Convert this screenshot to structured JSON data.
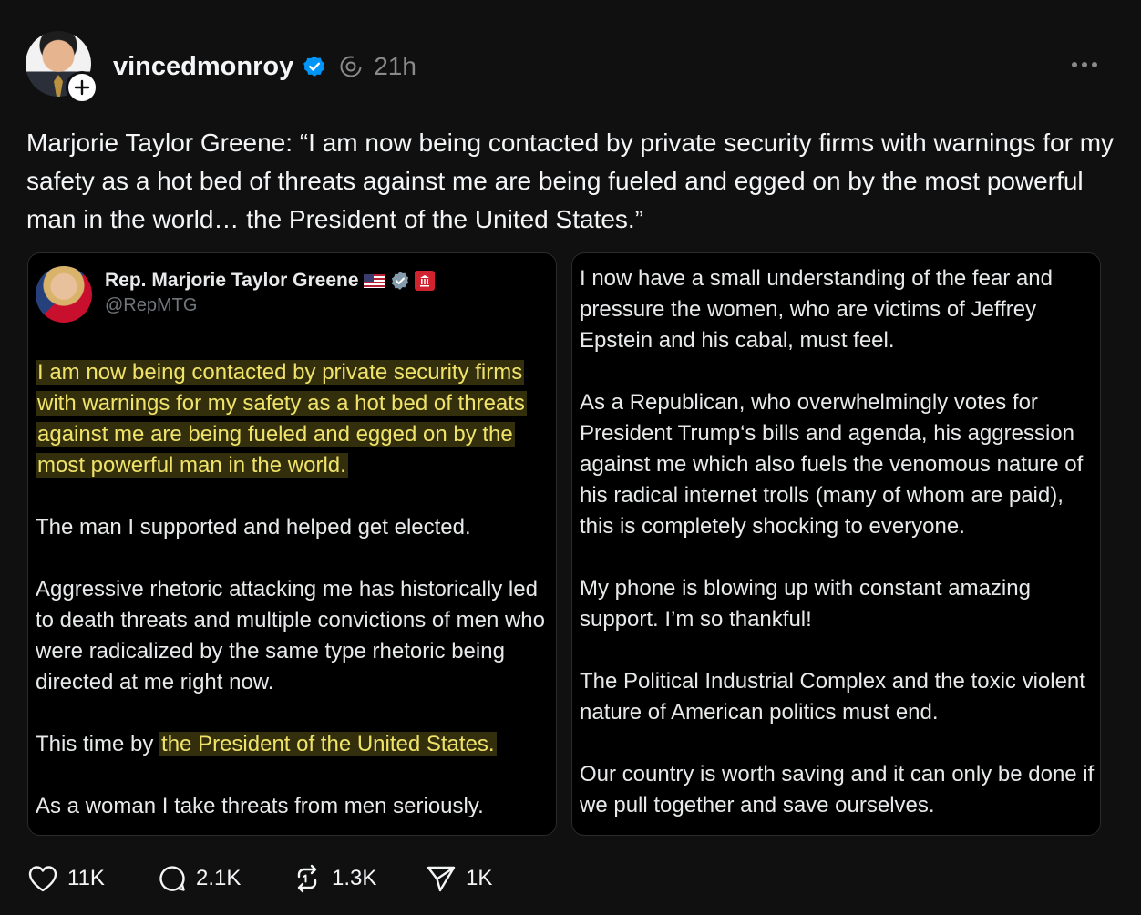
{
  "post": {
    "username": "vincedmonroy",
    "time": "21h",
    "text": "Marjorie Taylor Greene: “I am now being contacted by private security firms with warnings for my safety as a hot bed of threats against me are being fueled and egged on by the most powerful man in the world… the President of the United States.”"
  },
  "embedded_left": {
    "display_name": "Rep. Marjorie Taylor Greene",
    "handle": "@RepMTG",
    "highlight_1": "I am now being contacted by private security firms with warnings for my safety as a hot bed of threats against me are being fueled and egged on by the most powerful man in the world.",
    "para_2": "The man I supported and helped get elected.",
    "para_3": "Aggressive rhetoric attacking me has historically led to death threats and multiple convictions of men who were radicalized by the same type rhetoric being directed at me right now.",
    "para_4_prefix": "This time by ",
    "para_4_highlight": "the President of the United States.",
    "para_5": "As a woman I take threats from men seriously."
  },
  "embedded_right": {
    "para_1": "I now have a small understanding of the fear and pressure the women, who are victims of Jeffrey Epstein and his cabal, must feel.",
    "para_2": "As a Republican, who overwhelmingly votes for President Trump‘s bills and agenda, his aggression against me which also fuels the venomous nature of his radical internet trolls (many of whom are paid), this is completely shocking to everyone.",
    "para_3": "My phone is blowing up with constant amazing support. I’m so thankful!",
    "para_4": "The Political Industrial Complex and the toxic violent nature of American politics must end.",
    "para_5": "Our country is worth saving and it can only be done if we pull together and save ourselves."
  },
  "actions": {
    "likes": "11K",
    "replies": "2.1K",
    "reposts": "1.3K",
    "shares": "1K"
  },
  "icons": {
    "verified": "verified-badge-icon",
    "threads": "threads-icon",
    "more": "more-dots-icon",
    "like": "heart-icon",
    "reply": "comment-icon",
    "repost": "repost-icon",
    "share": "send-icon"
  },
  "colors": {
    "background": "#101010",
    "verified": "#0095f6",
    "highlight": "#f0e36a"
  }
}
